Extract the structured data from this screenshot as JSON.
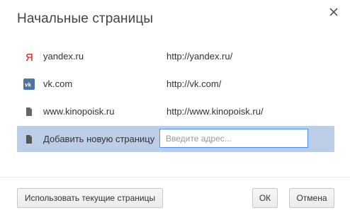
{
  "dialog": {
    "title": "Начальные страницы"
  },
  "icons": {
    "close": "close-icon",
    "yandex": "yandex-favicon-icon",
    "vk": "vk-favicon-icon",
    "page": "page-icon"
  },
  "pages": [
    {
      "name": "yandex.ru",
      "url": "http://yandex.ru/",
      "icon": "yandex-favicon-icon"
    },
    {
      "name": "vk.com",
      "url": "http://vk.com/",
      "icon": "vk-favicon-icon"
    },
    {
      "name": "www.kinopoisk.ru",
      "url": "http://www.kinopoisk.ru/",
      "icon": "page-icon"
    }
  ],
  "add_row": {
    "label": "Добавить новую страницу",
    "placeholder": "Введите адрес..."
  },
  "footer": {
    "use_current_label": "Использовать текущие страницы",
    "ok_label": "ОК",
    "cancel_label": "Отмена"
  },
  "colors": {
    "selection": "#bccde8",
    "yandex_red": "#e61400",
    "vk_blue": "#4c75a3",
    "focus_border": "#4d90fe"
  }
}
